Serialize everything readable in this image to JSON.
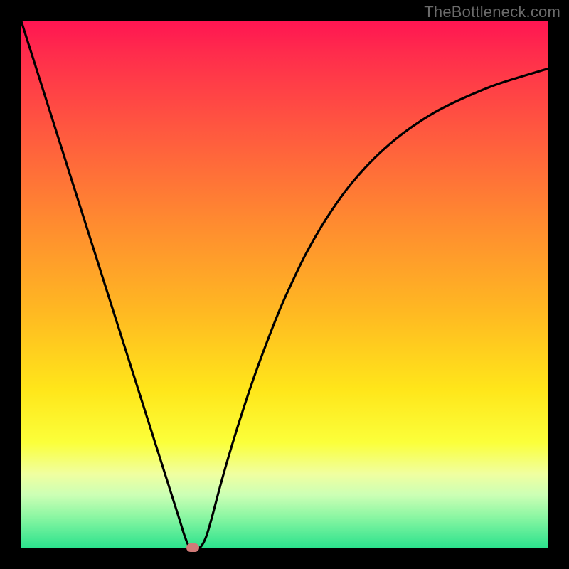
{
  "watermark": "TheBottleneck.com",
  "colors": {
    "frame": "#000000",
    "curve": "#000000",
    "marker": "#d07a78",
    "gradient_stops": [
      {
        "pos": 0.0,
        "color": "#ff1552"
      },
      {
        "pos": 0.06,
        "color": "#ff2c4c"
      },
      {
        "pos": 0.2,
        "color": "#ff5640"
      },
      {
        "pos": 0.38,
        "color": "#ff8a30"
      },
      {
        "pos": 0.55,
        "color": "#ffb822"
      },
      {
        "pos": 0.7,
        "color": "#ffe61a"
      },
      {
        "pos": 0.8,
        "color": "#fbff3a"
      },
      {
        "pos": 0.86,
        "color": "#f0ffa0"
      },
      {
        "pos": 0.9,
        "color": "#ccffb5"
      },
      {
        "pos": 0.94,
        "color": "#8df7a3"
      },
      {
        "pos": 1.0,
        "color": "#2ce28d"
      }
    ]
  },
  "chart_data": {
    "type": "line",
    "title": "",
    "xlabel": "",
    "ylabel": "",
    "xlim": [
      0,
      100
    ],
    "ylim": [
      0,
      100
    ],
    "x": [
      0,
      2,
      4,
      6,
      8,
      10,
      12,
      14,
      16,
      18,
      20,
      22,
      24,
      26,
      28,
      30,
      31,
      32,
      33,
      34,
      35,
      36,
      38,
      40,
      42,
      44,
      46,
      48,
      50,
      54,
      58,
      62,
      66,
      70,
      74,
      78,
      82,
      86,
      90,
      94,
      98,
      100
    ],
    "values": [
      100,
      93.7,
      87.4,
      81.1,
      74.8,
      68.5,
      62.2,
      55.9,
      49.6,
      43.3,
      37.0,
      30.7,
      24.4,
      18.1,
      11.8,
      5.5,
      2.3,
      0.0,
      0.0,
      0.1,
      1.8,
      5.0,
      12.5,
      19.4,
      25.8,
      31.8,
      37.3,
      42.5,
      47.3,
      55.7,
      62.6,
      68.3,
      72.9,
      76.7,
      79.8,
      82.4,
      84.5,
      86.3,
      87.9,
      89.2,
      90.4,
      91.0
    ],
    "marker": {
      "x": 32.5,
      "y": 0
    }
  }
}
